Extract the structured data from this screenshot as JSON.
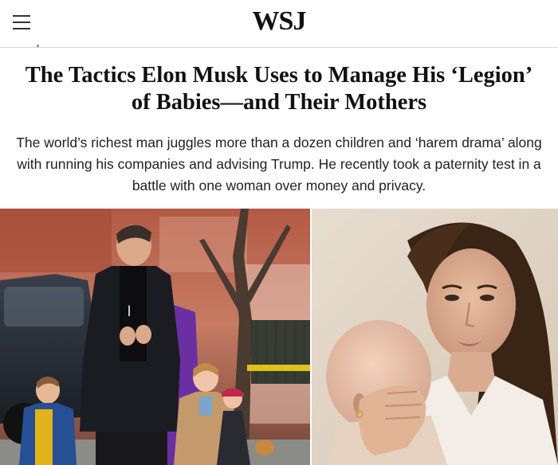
{
  "header": {
    "logo": "WSJ",
    "menu_icon": "hamburger-menu-icon"
  },
  "article": {
    "headline": "The Tactics Elon Musk Uses to Manage His ‘Legion’ of Babies—and Their Mothers",
    "dek": "The world’s richest man juggles more than a dozen children and ‘harem drama’ along with running his companies and advising Trump. He recently took a paternity test in a battle with one woman over money and privacy."
  },
  "photos": [
    {
      "name": "street-photo",
      "kind": "photo"
    },
    {
      "name": "mother-baby-photo",
      "kind": "photo"
    }
  ]
}
